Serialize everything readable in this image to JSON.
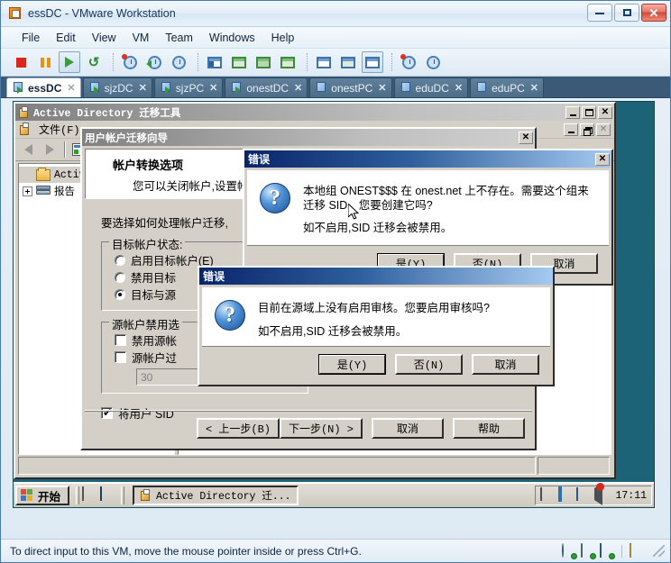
{
  "app": {
    "title": "essDC - VMware Workstation",
    "icon": "vmware-icon",
    "window_controls": {
      "minimize": "minimize-icon",
      "maximize": "maximize-icon",
      "close": "close-icon"
    }
  },
  "menubar": {
    "items": [
      {
        "label": "File",
        "name": "menu-file"
      },
      {
        "label": "Edit",
        "name": "menu-edit"
      },
      {
        "label": "View",
        "name": "menu-view"
      },
      {
        "label": "VM",
        "name": "menu-vm"
      },
      {
        "label": "Team",
        "name": "menu-team"
      },
      {
        "label": "Windows",
        "name": "menu-windows"
      },
      {
        "label": "Help",
        "name": "menu-help"
      }
    ]
  },
  "toolbar": {
    "buttons": [
      "power-off-icon",
      "suspend-icon",
      "power-on-icon",
      "reset-icon",
      "take-snapshot-icon",
      "revert-snapshot-icon",
      "snapshot-manager-icon",
      "show-sidebar-icon",
      "fullscreen-icon",
      "quick-switch-icon",
      "unity-icon",
      "settings-icon",
      "summary-view-icon",
      "console-view-icon",
      "capture-screen-icon",
      "capture-movie-icon"
    ]
  },
  "tabs": [
    {
      "label": "essDC",
      "active": true
    },
    {
      "label": "sjzDC",
      "active": false
    },
    {
      "label": "sjzPC",
      "active": false
    },
    {
      "label": "onestDC",
      "active": false
    },
    {
      "label": "onestPC",
      "active": false
    },
    {
      "label": "eduDC",
      "active": false
    },
    {
      "label": "eduPC",
      "active": false
    }
  ],
  "guest": {
    "mmc": {
      "title": "Active Directory 迁移工具",
      "menu": {
        "file": "文件(F)"
      },
      "tree": {
        "root": "Active D",
        "child": "报告"
      },
      "buttons": {
        "minimize": "minimize-icon",
        "maximize": "maximize-icon",
        "close": "close-icon"
      },
      "mdi_child_buttons": {
        "minimize": "minimize-icon",
        "restore": "restore-icon",
        "close": "close-icon"
      }
    },
    "wizard": {
      "title": "用户帐户迁移向导",
      "close_label": "×",
      "header_title": "帐户转换选项",
      "header_sub": "您可以关闭帐户,设置帐",
      "intro": "要选择如何处理帐户迁移,",
      "group_target": {
        "title": "目标帐户状态:",
        "options": [
          {
            "label": "启用目标帐户(E)",
            "selected": false
          },
          {
            "label": "禁用目标",
            "selected": false
          },
          {
            "label": "目标与源",
            "selected": true
          }
        ]
      },
      "group_source": {
        "title": "源帐户禁用选",
        "checkboxes": [
          {
            "label": "禁用源帐",
            "checked": false
          },
          {
            "label": "源帐户过",
            "checked": false
          }
        ],
        "days_value": "30"
      },
      "sid_checkbox": {
        "label": "将用户 SID",
        "checked": true
      },
      "buttons": {
        "back": "< 上一步(B)",
        "next": "下一步(N) >",
        "cancel": "取消",
        "help": "帮助"
      }
    },
    "error_dialog_1": {
      "title": "错误",
      "close_label": "×",
      "icon": "question-icon",
      "line1": "本地组 ONEST$$$ 在 onest.net 上不存在。需要这个组来迁移 SID。您要创建它吗?",
      "line2": "如不启用,SID 迁移会被禁用。",
      "buttons": {
        "yes": "是(Y)",
        "no": "否(N)",
        "cancel": "取消"
      },
      "default_button": "yes"
    },
    "error_dialog_2": {
      "title": "错误",
      "icon": "question-icon",
      "line1": "目前在源域上没有启用审核。您要启用审核吗?",
      "line2": "如不启用,SID 迁移会被禁用。",
      "buttons": {
        "yes": "是(Y)",
        "no": "否(N)",
        "cancel": "取消"
      },
      "default_button": "yes"
    },
    "taskbar": {
      "start_label": "开始",
      "quicklaunch": [
        "show-desktop-icon",
        "display-icon"
      ],
      "task_button": "Active Directory 迁...",
      "tray_icons": [
        "network-icon",
        "vmware-tools-icon",
        "display-icon",
        "volume-muted-icon"
      ],
      "clock": "17:11"
    }
  },
  "statusbar": {
    "message": "To direct input to this VM, move the mouse pointer inside or press Ctrl+G.",
    "device_icons": [
      "cd-drive-icon",
      "hard-disk-icon",
      "network-adapter-icon",
      "message-log-icon"
    ]
  },
  "colors": {
    "vm_chrome": "#dde9f4",
    "tab_strip": "#3a5a77",
    "guest_desktop": "#1d6378",
    "win9x_face": "#d4d0c8",
    "dialog_title": "#0a246a",
    "accent_red": "#d8271c"
  }
}
